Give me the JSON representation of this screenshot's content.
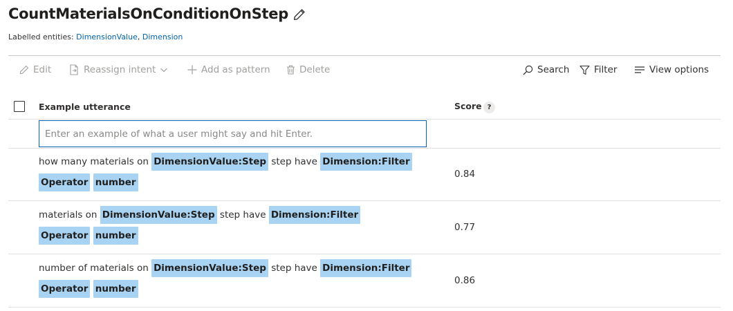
{
  "intent": {
    "title": "CountMaterialsOnConditionOnStep",
    "edit_icon": "pencil-icon"
  },
  "labelled_entities": {
    "label": "Labelled entities:",
    "items": [
      "DimensionValue",
      "Dimension"
    ]
  },
  "toolbar": {
    "edit": "Edit",
    "reassign": "Reassign intent",
    "add_pattern": "Add as pattern",
    "delete": "Delete",
    "search": "Search",
    "filter": "Filter",
    "view_options": "View options"
  },
  "table": {
    "col_utterance": "Example utterance",
    "col_score": "Score",
    "help_icon": "?",
    "input_placeholder": "Enter an example of what a user might say and hit Enter.",
    "rows": [
      {
        "tokens": [
          {
            "type": "text",
            "value": "how many materials on"
          },
          {
            "type": "entity",
            "value": "DimensionValue:Step"
          },
          {
            "type": "text",
            "value": "step have"
          },
          {
            "type": "entity",
            "value": "Dimension:Filter"
          },
          {
            "type": "entity",
            "value": "Operator"
          },
          {
            "type": "entity",
            "value": "number"
          }
        ],
        "score": "0.84"
      },
      {
        "tokens": [
          {
            "type": "text",
            "value": "materials on"
          },
          {
            "type": "entity",
            "value": "DimensionValue:Step"
          },
          {
            "type": "text",
            "value": "step have"
          },
          {
            "type": "entity",
            "value": "Dimension:Filter"
          },
          {
            "type": "entity",
            "value": "Operator"
          },
          {
            "type": "entity",
            "value": "number"
          }
        ],
        "score": "0.77"
      },
      {
        "tokens": [
          {
            "type": "text",
            "value": "number of materials on"
          },
          {
            "type": "entity",
            "value": "DimensionValue:Step"
          },
          {
            "type": "text",
            "value": "step have"
          },
          {
            "type": "entity",
            "value": "Dimension:Filter"
          },
          {
            "type": "entity",
            "value": "Operator"
          },
          {
            "type": "entity",
            "value": "number"
          }
        ],
        "score": "0.86"
      }
    ]
  },
  "colors": {
    "link": "#0062ad",
    "entity_highlight": "#a9d3f2",
    "disabled_text": "#a19f9d"
  }
}
